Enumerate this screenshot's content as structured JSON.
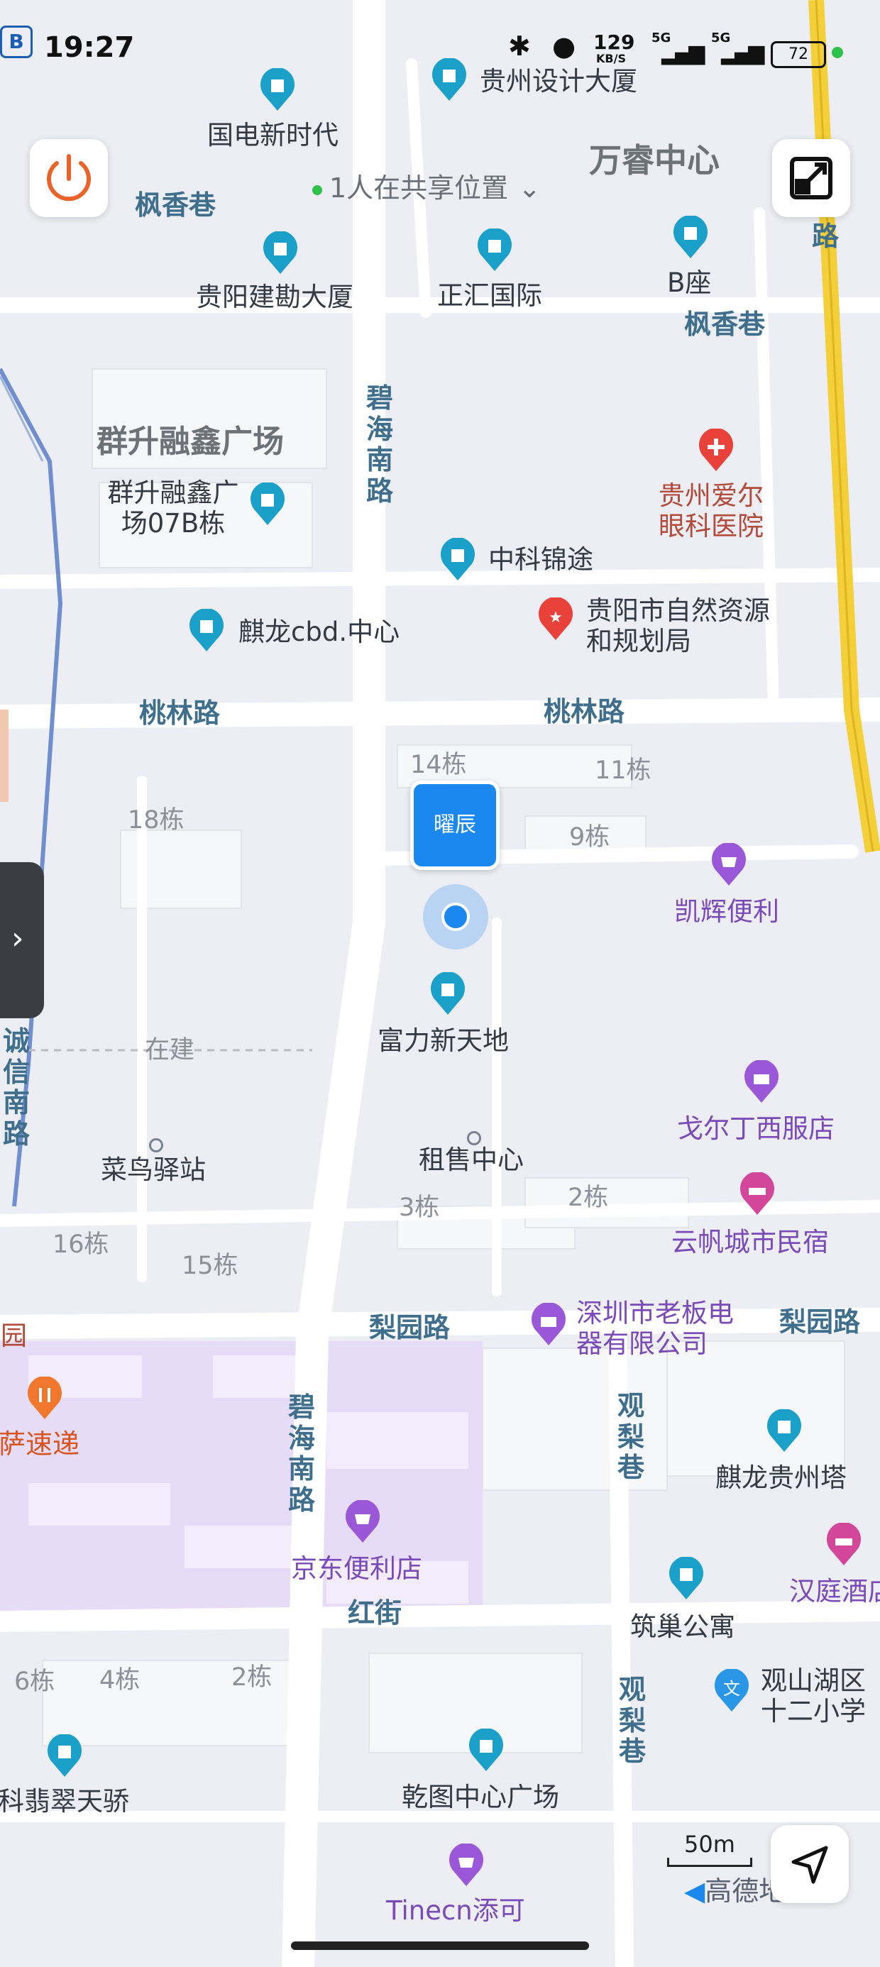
{
  "status_bar": {
    "time": "19:27",
    "net_speed": "129",
    "net_unit": "KB/S",
    "signal1": "5G",
    "signal2": "5G",
    "battery": "72"
  },
  "sharing": {
    "text": "1人在共享位置"
  },
  "user_marker": {
    "label": "曜辰"
  },
  "scale": {
    "label": "50m"
  },
  "brand": {
    "logo_text": "高德地图"
  },
  "roads": [
    "碧海南路",
    "桃林路",
    "桃林路",
    "梨园路",
    "梨园路",
    "碧海南路",
    "红街",
    "观梨巷",
    "观梨巷",
    "枫香巷",
    "枫香巷",
    "诚信南路",
    "路"
  ],
  "areas": {
    "big1": "群升融鑫广场",
    "big2": "万睿中心"
  },
  "pois": {
    "guodian": "国电新时代",
    "guizhou_design": "贵州设计大厦",
    "gy_jiankan": "贵阳建勘大厦",
    "zhenghui": "正汇国际",
    "b_zuo": "B座",
    "qunsheng_07b": "群升融鑫广场07B栋",
    "aier": "贵州爱尔眼科医院",
    "zhongke": "中科锦途",
    "qilong_cbd": "麒龙cbd.中心",
    "ziran": "贵阳市自然资源和规划局",
    "kaihui": "凯辉便利",
    "fuli": "富力新天地",
    "zaijian": "在建",
    "ge_er_ding": "戈尔丁西服店",
    "cainiao": "菜鸟驿站",
    "zushou": "租售中心",
    "yunfan": "云帆城市民宿",
    "shenzhen_lb": "深圳市老板电器有限公司",
    "hua_yuan": "花园",
    "pizza": "披萨速递",
    "jd": "京东便利店",
    "qilong_gz": "麒龙贵州塔",
    "hanting": "汉庭酒店",
    "zhuchao": "筑巢公寓",
    "guanshanhu": "观山湖区十二小学",
    "wanke": "万科翡翠天骄",
    "qiantu": "乾图中心广场",
    "tinecn": "Tinecn添可"
  },
  "buildings": [
    "14栋",
    "11栋",
    "18栋",
    "9栋",
    "3栋",
    "2栋",
    "16栋",
    "15栋",
    "6栋",
    "4栋",
    "2栋"
  ],
  "colors": {
    "poi_blue": "#1aa0c9",
    "shop_purple": "#9a58d9",
    "food_orange": "#f0782e",
    "red": "#e8423a",
    "user_blue": "#1b88f0",
    "hotel_pink": "#d3479b",
    "school_blue": "#2a96e6"
  }
}
